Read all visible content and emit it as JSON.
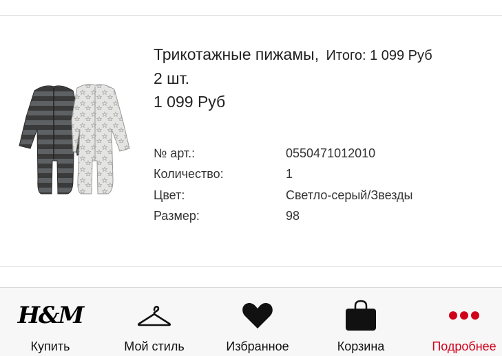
{
  "product": {
    "name": "Трикотажные пижамы,",
    "total": "Итого: 1 099 Руб",
    "quantity_line": "2 шт.",
    "price": "1 099 Руб",
    "details": [
      {
        "label": "№ арт.:",
        "value": "0550471012010"
      },
      {
        "label": "Количество:",
        "value": "1"
      },
      {
        "label": "Цвет:",
        "value": "Светло-серый/Звезды"
      },
      {
        "label": "Размер:",
        "value": "98"
      }
    ]
  },
  "tabbar": {
    "active_color": "#d0021b",
    "items": [
      {
        "label": "Купить",
        "icon": "hm-logo-icon",
        "logo_text": "H&M"
      },
      {
        "label": "Мой стиль",
        "icon": "hanger-icon"
      },
      {
        "label": "Избранное",
        "icon": "heart-icon"
      },
      {
        "label": "Корзина",
        "icon": "shopping-bag-icon"
      },
      {
        "label": "Подробнее",
        "icon": "more-dots-icon",
        "active": true
      }
    ]
  }
}
